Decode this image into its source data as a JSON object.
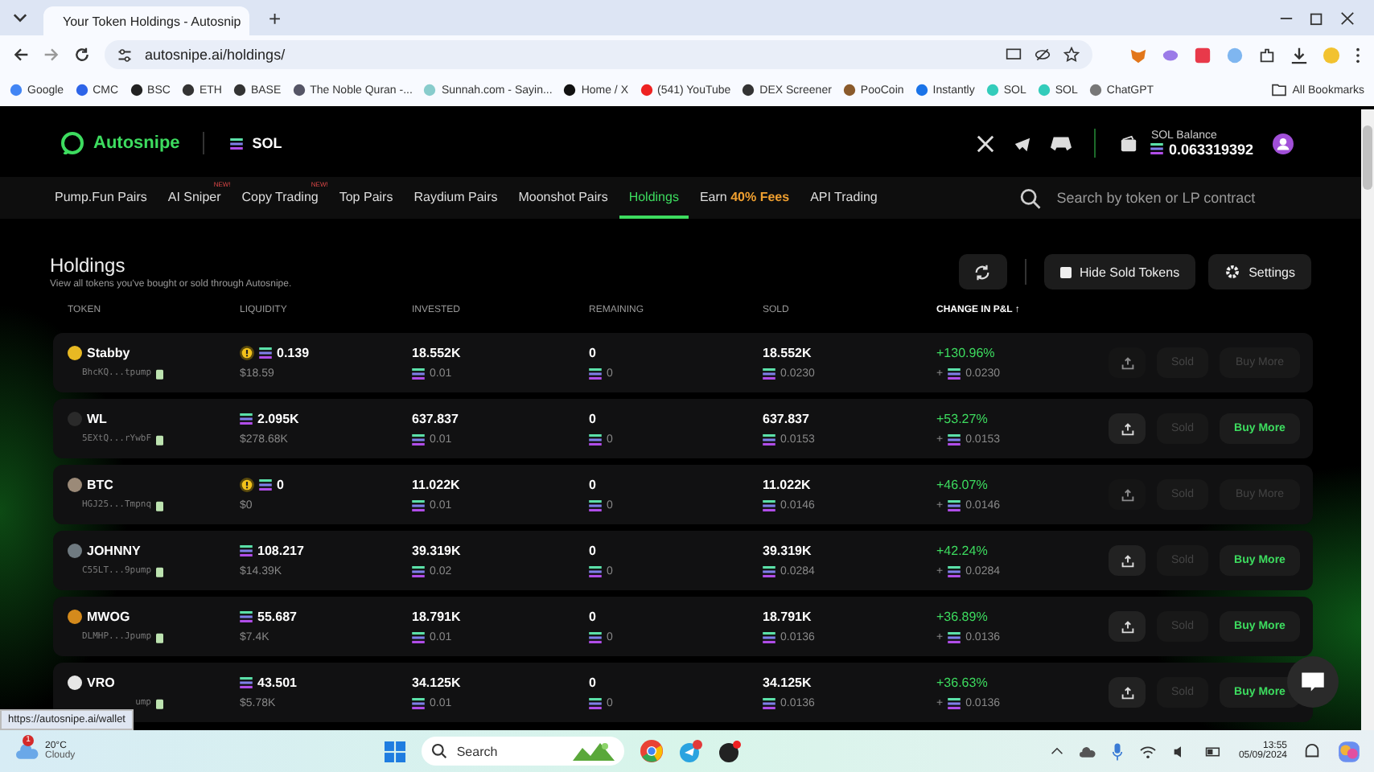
{
  "browser": {
    "tab_title": "Your Token Holdings - Autosnip",
    "new_tab": "+",
    "url": "autosnipe.ai/holdings/",
    "bookmarks": [
      "Google",
      "CMC",
      "BSC",
      "ETH",
      "BASE",
      "The Noble Quran -...",
      "Sunnah.com - Sayin...",
      "Home / X",
      "(541) YouTube",
      "DEX Screener",
      "PooCoin",
      "Instantly",
      "SOL",
      "SOL",
      "ChatGPT"
    ],
    "all_bookmarks": "All Bookmarks"
  },
  "header": {
    "logo": "Autosnipe",
    "chain": "SOL",
    "balance_label": "SOL Balance",
    "balance": "0.063319392"
  },
  "nav": {
    "items": [
      {
        "label": "Pump.Fun Pairs",
        "selected": false
      },
      {
        "label": "AI Sniper",
        "badge": "NEW!",
        "selected": false
      },
      {
        "label": "Copy Trading",
        "badge": "NEW!",
        "selected": false
      },
      {
        "label": "Top Pairs",
        "selected": false
      },
      {
        "label": "Raydium Pairs",
        "selected": false
      },
      {
        "label": "Moonshot Pairs",
        "selected": false
      },
      {
        "label": "Holdings",
        "selected": true
      },
      {
        "label": "Earn",
        "highlight": "40% Fees",
        "selected": false
      },
      {
        "label": "API Trading",
        "selected": false
      }
    ],
    "search_placeholder": "Search by token or LP contract"
  },
  "holdings": {
    "title": "Holdings",
    "subtitle": "View all tokens you've bought or sold through Autosnipe.",
    "hide_sold": {
      "label": "Hide Sold Tokens",
      "checked": false
    },
    "settings": "Settings"
  },
  "table": {
    "columns": [
      "TOKEN",
      "LIQUIDITY",
      "INVESTED",
      "REMAINING",
      "SOLD",
      "CHANGE IN P&L ↑"
    ],
    "rows": [
      {
        "name": "Stabby",
        "address": "BhcKQ...tpump",
        "color": "#e8b923",
        "warning": true,
        "liquidity": "0.139",
        "liquidity_usd": "$18.59",
        "invested": "18.552K",
        "invested_sol": "0.01",
        "remaining": "0",
        "remaining_sol": "0",
        "sold": "18.552K",
        "sold_sol": "0.0230",
        "change": "+130.96%",
        "change_sign": "+",
        "change_sol": "0.0230",
        "sold_label": "Sold",
        "buy_label": "Buy More",
        "buy_disabled": true
      },
      {
        "name": "WL",
        "address": "5EXtQ...rYwbF",
        "color": "#2a2a2a",
        "warning": false,
        "liquidity": "2.095K",
        "liquidity_usd": "$278.68K",
        "invested": "637.837",
        "invested_sol": "0.01",
        "remaining": "0",
        "remaining_sol": "0",
        "sold": "637.837",
        "sold_sol": "0.0153",
        "change": "+53.27%",
        "change_sign": "+",
        "change_sol": "0.0153",
        "sold_label": "Sold",
        "buy_label": "Buy More",
        "buy_disabled": false
      },
      {
        "name": "BTC",
        "address": "HGJ25...Tmpnq",
        "color": "#9b8a78",
        "warning": true,
        "liquidity": "0",
        "liquidity_usd": "$0",
        "invested": "11.022K",
        "invested_sol": "0.01",
        "remaining": "0",
        "remaining_sol": "0",
        "sold": "11.022K",
        "sold_sol": "0.0146",
        "change": "+46.07%",
        "change_sign": "+",
        "change_sol": "0.0146",
        "sold_label": "Sold",
        "buy_label": "Buy More",
        "buy_disabled": true
      },
      {
        "name": "JOHNNY",
        "address": "C55LT...9pump",
        "color": "#6f7a80",
        "warning": false,
        "liquidity": "108.217",
        "liquidity_usd": "$14.39K",
        "invested": "39.319K",
        "invested_sol": "0.02",
        "remaining": "0",
        "remaining_sol": "0",
        "sold": "39.319K",
        "sold_sol": "0.0284",
        "change": "+42.24%",
        "change_sign": "+",
        "change_sol": "0.0284",
        "sold_label": "Sold",
        "buy_label": "Buy More",
        "buy_disabled": false
      },
      {
        "name": "MWOG",
        "address": "DLMHP...Jpump",
        "color": "#d48a1c",
        "warning": false,
        "liquidity": "55.687",
        "liquidity_usd": "$7.4K",
        "invested": "18.791K",
        "invested_sol": "0.01",
        "remaining": "0",
        "remaining_sol": "0",
        "sold": "18.791K",
        "sold_sol": "0.0136",
        "change": "+36.89%",
        "change_sign": "+",
        "change_sol": "0.0136",
        "sold_label": "Sold",
        "buy_label": "Buy More",
        "buy_disabled": false
      },
      {
        "name": "VRO",
        "address": "ump",
        "color": "#e6e6e6",
        "warning": false,
        "liquidity": "43.501",
        "liquidity_usd": "$5.78K",
        "invested": "34.125K",
        "invested_sol": "0.01",
        "remaining": "0",
        "remaining_sol": "0",
        "sold": "34.125K",
        "sold_sol": "0.0136",
        "change": "+36.63%",
        "change_sign": "+",
        "change_sol": "0.0136",
        "sold_label": "Sold",
        "buy_label": "Buy More",
        "buy_disabled": false
      }
    ]
  },
  "status_link": "https://autosnipe.ai/wallet",
  "taskbar": {
    "weather_badge": "1",
    "temperature": "20°C",
    "condition": "Cloudy",
    "search": "Search",
    "time": "13:55",
    "date": "05/09/2024"
  }
}
